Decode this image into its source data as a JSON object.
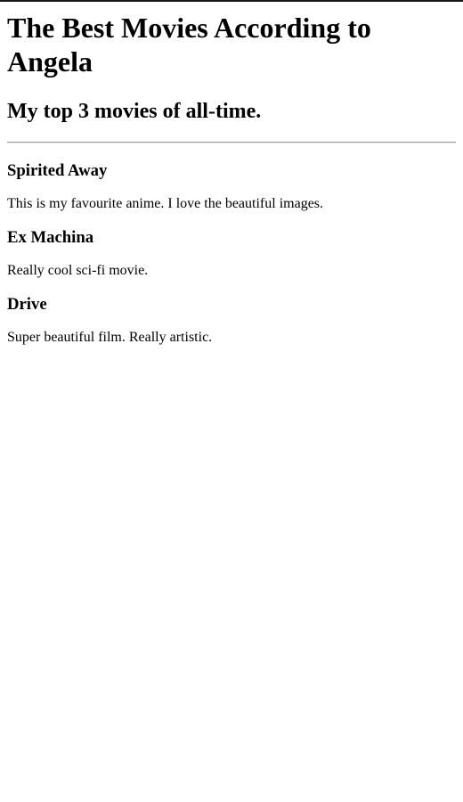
{
  "page": {
    "title": "The Best Movies According to Angela",
    "subtitle": "My top 3 movies of all-time."
  },
  "movies": [
    {
      "name": "Spirited Away",
      "description": "This is my favourite anime. I love the beautiful images."
    },
    {
      "name": "Ex Machina",
      "description": "Really cool sci-fi movie."
    },
    {
      "name": "Drive",
      "description": "Super beautiful film. Really artistic."
    }
  ]
}
